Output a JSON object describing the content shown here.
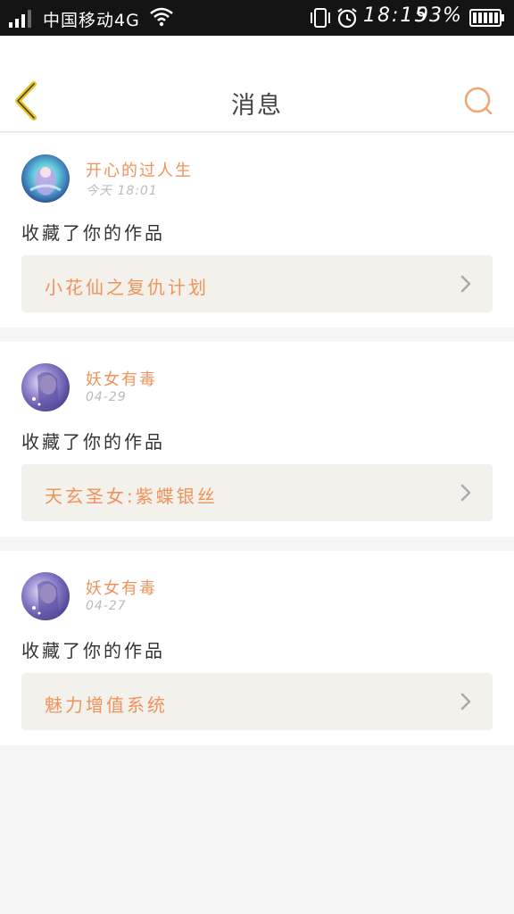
{
  "status_bar": {
    "carrier": "中国移动4G",
    "time": "18:15",
    "battery_percent": "93%",
    "icons": [
      "signal-icon",
      "wifi-icon",
      "vibrate-icon",
      "alarm-icon",
      "battery-icon"
    ]
  },
  "header": {
    "title": "消息",
    "back_icon": "chevron-left-icon",
    "search_icon": "search-icon"
  },
  "colors": {
    "accent": "#f0925a",
    "back_arrow": "#e8c21a",
    "link_bg": "#f2f1ec"
  },
  "messages": [
    {
      "user": "开心的过人生",
      "time": "今天 18:01",
      "action": "收藏了你的作品",
      "work_title": "小花仙之复仇计划",
      "avatar_icon": "avatar-fairy"
    },
    {
      "user": "妖女有毒",
      "time": "04-29",
      "action": "收藏了你的作品",
      "work_title": "天玄圣女:紫蝶银丝",
      "avatar_icon": "avatar-girl"
    },
    {
      "user": "妖女有毒",
      "time": "04-27",
      "action": "收藏了你的作品",
      "work_title": "魅力增值系统",
      "avatar_icon": "avatar-girl"
    }
  ]
}
